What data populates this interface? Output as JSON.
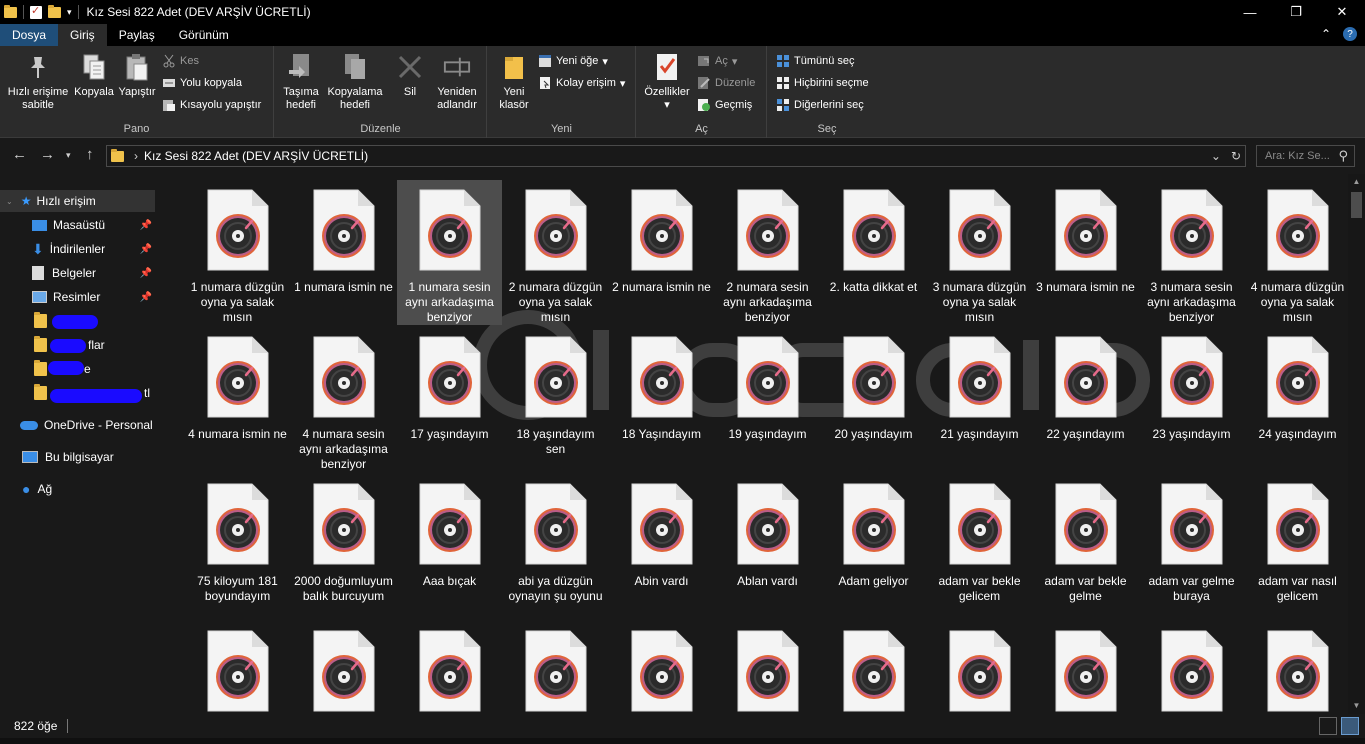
{
  "window": {
    "title": "Kız Sesi 822 Adet (DEV ARŞİV ÜCRETLİ)"
  },
  "ribbon_tabs": [
    "Dosya",
    "Giriş",
    "Paylaş",
    "Görünüm"
  ],
  "ribbon": {
    "groups": [
      "Pano",
      "Düzenle",
      "Yeni",
      "Aç",
      "Seç"
    ],
    "pano": {
      "pin": "Hızlı erişime sabitle",
      "copy": "Kopyala",
      "paste": "Yapıştır",
      "cut": "Kes",
      "copy_path": "Yolu kopyala",
      "paste_shortcut": "Kısayolu yapıştır"
    },
    "duzenle": {
      "move_to": "Taşıma hedefi",
      "copy_to": "Kopyalama hedefi",
      "delete": "Sil",
      "rename": "Yeniden adlandır"
    },
    "yeni": {
      "new_folder": "Yeni klasör",
      "new_item": "Yeni öğe",
      "easy_access": "Kolay erişim"
    },
    "ac": {
      "properties": "Özellikler",
      "open": "Aç",
      "edit": "Düzenle",
      "history": "Geçmiş"
    },
    "sec": {
      "select_all": "Tümünü seç",
      "select_none": "Hiçbirini seçme",
      "invert": "Diğerlerini seç"
    }
  },
  "address": {
    "path": "Kız Sesi 822 Adet (DEV ARŞİV ÜCRETLİ)",
    "search_placeholder": "Ara: Kız Se..."
  },
  "sidebar": {
    "quick_access": "Hızlı erişim",
    "pinned": [
      "Masaüstü",
      "İndirilenler",
      "Belgeler",
      "Resimler"
    ],
    "hidden_labels": [
      "",
      "flar",
      "e",
      "tl"
    ],
    "onedrive": "OneDrive - Personal",
    "this_pc": "Bu bilgisayar",
    "network": "Ağ"
  },
  "files": [
    "1 numara düzgün oyna ya salak mısın",
    "1 numara ismin ne",
    "1 numara sesin aynı arkadaşıma benziyor",
    "2 numara düzgün oyna ya salak mısın",
    "2 numara ismin ne",
    "2 numara sesin aynı arkadaşıma benziyor",
    "2. katta dikkat et",
    "3 numara düzgün oyna ya salak mısın",
    "3 numara ismin ne",
    "3 numara sesin aynı arkadaşıma benziyor",
    "4 numara düzgün oyna ya salak mısın",
    "4 numara ismin ne",
    "4 numara sesin aynı arkadaşıma benziyor",
    "17 yaşındayım",
    "18 yaşındayım sen",
    "18 Yaşındayım",
    "19 yaşındayım",
    "20 yaşındayım",
    "21 yaşındayım",
    "22 yaşındayım",
    "23 yaşındayım",
    "24 yaşındayım",
    "75 kiloyum 181 boyundayım",
    "2000 doğumluyum balık burcuyum",
    "Aaa bıçak",
    "abi ya düzgün oynayın şu oyunu",
    "Abin vardı",
    "Ablan vardı",
    "Adam geliyor",
    "adam var bekle gelicem",
    "adam var bekle gelme",
    "adam var gelme buraya",
    "adam var nasıl gelicem",
    "",
    "",
    "",
    "",
    "",
    "",
    "",
    "",
    "",
    "",
    ""
  ],
  "selected_file_index": 2,
  "status": {
    "count": "822 öğe"
  },
  "colors": {
    "background": "#191919",
    "ribbon": "#2b2b2b",
    "file_tab": "#1f4e79",
    "selection": "#4d4d4d"
  }
}
